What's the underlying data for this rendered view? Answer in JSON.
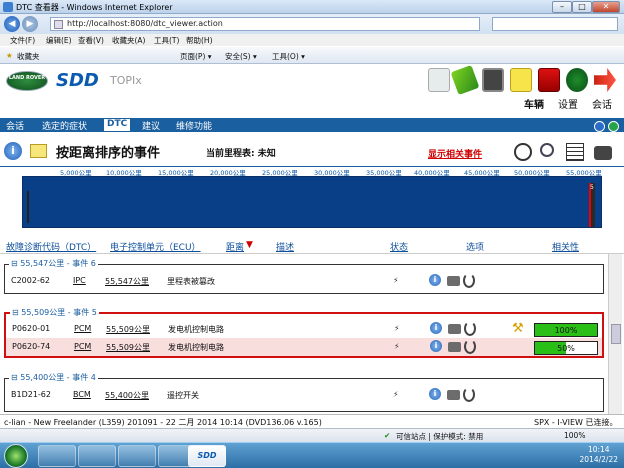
{
  "window": {
    "title": "DTC 查看器 - Windows Internet Explorer"
  },
  "browser": {
    "url": "http://localhost:8080/dtc_viewer.action",
    "menu": [
      "文件(F)",
      "编辑(E)",
      "查看(V)",
      "收藏夹(A)",
      "工具(T)",
      "帮助(H)"
    ],
    "favorites": "收藏夹",
    "fav_tools": [
      "页面(P) ▾",
      "安全(S) ▾",
      "工具(O) ▾"
    ]
  },
  "sdd": {
    "logo": "LAND ROVER",
    "brand": "SDD",
    "product": "TOPIx",
    "top_links": [
      "车辆",
      "设置",
      "会话"
    ]
  },
  "tabs": [
    "会话",
    "选定的症状",
    "DTC",
    "建议",
    "维修功能"
  ],
  "active_tab": "DTC",
  "page": {
    "title": "按距离排序的事件",
    "current_mileage": "当前里程表: 未知",
    "show_related": "显示相关事件"
  },
  "scale": {
    "ticks": [
      "5,000公里",
      "10,000公里",
      "15,000公里",
      "20,000公里",
      "25,000公里",
      "30,000公里",
      "35,000公里",
      "40,000公里",
      "45,000公里",
      "50,000公里",
      "55,000公里"
    ],
    "marker_count": "5"
  },
  "columns": {
    "code": "故障诊断代码（DTC）",
    "ecu": "电子控制单元（ECU）",
    "distance": "距离",
    "desc": "描述",
    "status": "状态",
    "options": "选项",
    "relevance": "相关性"
  },
  "events": [
    {
      "title": "55,547公里 - 事件 6",
      "rows": [
        {
          "dtc": "C2002-62",
          "ecu": "IPC",
          "dist": "55,547公里",
          "desc": "里程表被篡改",
          "relevance": null
        }
      ]
    },
    {
      "title": "55,509公里 - 事件 5",
      "rows": [
        {
          "dtc": "P0620-01",
          "ecu": "PCM",
          "dist": "55,509公里",
          "desc": "发电机控制电路",
          "relevance": "100%",
          "relevance_value": 100
        },
        {
          "dtc": "P0620-74",
          "ecu": "PCM",
          "dist": "55,509公里",
          "desc": "发电机控制电路",
          "relevance": "50%",
          "relevance_value": 50
        }
      ]
    },
    {
      "title": "55,400公里 - 事件 4",
      "rows": [
        {
          "dtc": "B1D21-62",
          "ecu": "BCM",
          "dist": "55,400公里",
          "desc": "遥控开关",
          "relevance": null
        }
      ]
    }
  ],
  "status": {
    "vehicle": "c-lian - New Freelander (L359) 201091 - 22 二月 2014 10:14 (DVD136.06 v.165)",
    "right": "SPX - I-VIEW 已连接。"
  },
  "ie_status": {
    "zone": "可信站点 | 保护模式: 禁用",
    "zoom": "100%"
  },
  "clock": {
    "time": "10:14",
    "date": "2014/2/22"
  },
  "taskbar": {
    "sdd": "SDD"
  },
  "colors": {
    "accent": "#1a5fa0",
    "timeline": "#083f86",
    "alert": "#d00000",
    "bar": "#29bf17"
  }
}
